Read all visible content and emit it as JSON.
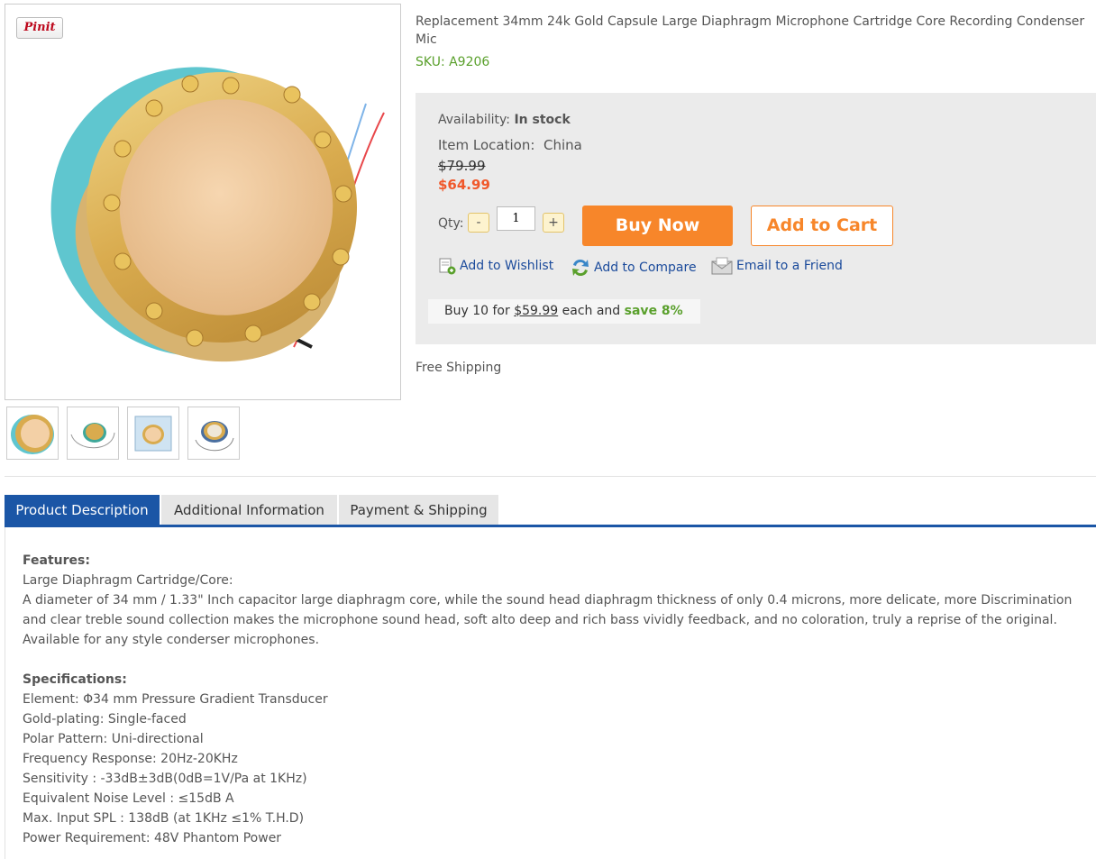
{
  "product": {
    "title": "Replacement 34mm 24k Gold Capsule Large Diaphragm Microphone Cartridge Core Recording Condenser Mic",
    "sku": "SKU: A9206",
    "pin_label": "Pinit",
    "thumbnail_count": 4
  },
  "buybox": {
    "availability_label": "Availability:",
    "availability_value": "In stock",
    "location_label": "Item Location:",
    "location_value": "China",
    "old_price": "$79.99",
    "new_price": "$64.99",
    "qty_label": "Qty:",
    "qty_minus": "-",
    "qty_value": "1",
    "qty_plus": "+",
    "buy_now": "Buy Now",
    "add_to_cart": "Add to Cart",
    "wishlist": "Add to Wishlist",
    "compare": "Add to Compare",
    "email": "Email to a Friend",
    "bulk_prefix": "Buy 10 for",
    "bulk_price": "$59.99",
    "bulk_middle": "each and",
    "bulk_save": "save 8%"
  },
  "shipping": "Free Shipping",
  "tabs": [
    {
      "label": "Product Description"
    },
    {
      "label": "Additional Information"
    },
    {
      "label": "Payment & Shipping"
    }
  ],
  "description": {
    "features_heading": "Features:",
    "features_sub": "Large Diaphragm Cartridge/Core:",
    "features_text": "A diameter of 34 mm / 1.33\" Inch capacitor large diaphragm core, while the sound head diaphragm thickness of only 0.4 microns, more delicate, more Discrimination and clear treble sound collection makes the microphone sound head, soft alto deep and rich bass vividly feedback, and no coloration, truly a reprise of the original.",
    "features_text2": "Available for any style conderser microphones.",
    "spec_heading": "Specifications:",
    "specs": [
      "Element: Φ34 mm Pressure Gradient Transducer",
      "Gold-plating: Single-faced",
      "Polar Pattern: Uni-directional",
      "Frequency Response: 20Hz-20KHz",
      "Sensitivity : -33dB±3dB(0dB=1V/Pa at 1KHz)",
      "Equivalent Noise Level : ≤15dB A",
      "Max. Input SPL : 138dB (at 1KHz ≤1% T.H.D)",
      "Power Requirement: 48V Phantom Power"
    ]
  },
  "colors": {
    "accent_orange": "#f7862a",
    "price_red": "#f0582b",
    "sku_green": "#5aa02c",
    "tab_blue": "#1b56a6",
    "link_blue": "#1a4a9b"
  }
}
